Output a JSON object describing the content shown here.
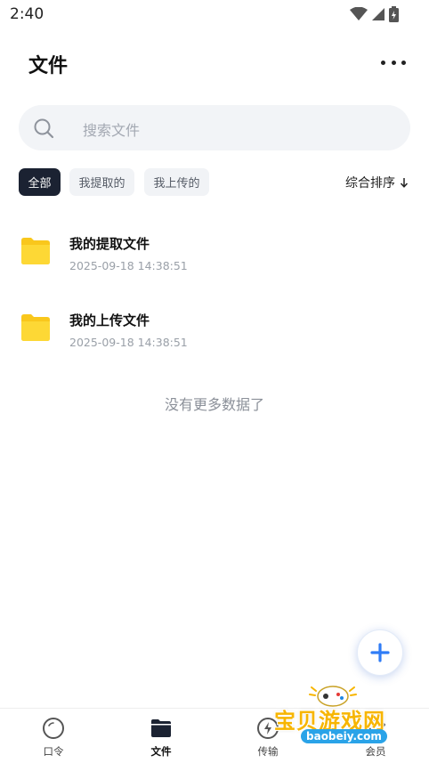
{
  "status_bar": {
    "time": "2:40",
    "icons": [
      "wifi-icon",
      "signal-icon",
      "battery-icon"
    ]
  },
  "header": {
    "title": "文件",
    "more_icon": "more-dots-icon"
  },
  "search": {
    "placeholder": "搜索文件",
    "icon": "search-icon"
  },
  "filters": {
    "chips": [
      {
        "label": "全部",
        "active": true
      },
      {
        "label": "我提取的",
        "active": false
      },
      {
        "label": "我上传的",
        "active": false
      }
    ],
    "sort_label": "综合排序",
    "sort_icon": "arrow-down-icon"
  },
  "files": [
    {
      "name": "我的提取文件",
      "date": "2025-09-18 14:38:51",
      "icon": "folder-icon"
    },
    {
      "name": "我的上传文件",
      "date": "2025-09-18 14:38:51",
      "icon": "folder-icon"
    }
  ],
  "list_end_text": "没有更多数据了",
  "fab": {
    "icon": "plus-icon"
  },
  "tab_bar": {
    "tabs": [
      {
        "label": "口令",
        "icon": "kouling-icon",
        "active": false
      },
      {
        "label": "文件",
        "icon": "folder-tab-icon",
        "active": true
      },
      {
        "label": "传输",
        "icon": "transfer-icon",
        "active": false
      },
      {
        "label": "会员",
        "icon": "vip-icon",
        "active": false
      }
    ]
  },
  "watermark": {
    "title": "宝贝游戏网",
    "url": "baobeiy.com"
  },
  "colors": {
    "accent": "#1b2232",
    "folder": "#fdd835",
    "fab_plus": "#2f7cf6",
    "watermark": "#f7b500"
  }
}
